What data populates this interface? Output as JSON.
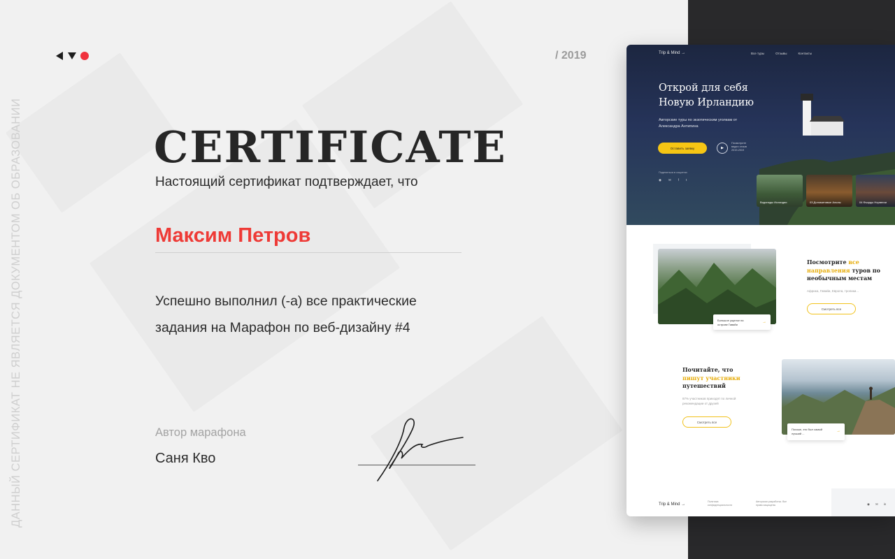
{
  "certificate": {
    "title": "CERTIFICATE",
    "subtitle": "Настоящий сертификат подтверждает, что",
    "recipient": "Максим Петров",
    "body_line1": "Успешно выполнил (-а) все практические",
    "body_line2": "задания на Марафон по веб-дизайну #4",
    "author_label": "Автор марафона",
    "author_name": "Саня Кво",
    "year": "/ 2019",
    "disclaimer": "ДАННЫЙ СЕРТИФИКАТ НЕ ЯВЛЯЕТСЯ ДОКУМЕНТОМ ОБ ОБРАЗОВАНИИ"
  },
  "colors": {
    "accent_red": "#ee3a36",
    "accent_yellow": "#f6c614",
    "dark_panel": "#29292b"
  },
  "logo": {
    "icons": [
      "triangle-left-icon",
      "triangle-down-icon",
      "red-dot-icon"
    ]
  },
  "mockup": {
    "logo": "Trip & Mind →",
    "nav": [
      "Все туры",
      "Отзывы",
      "Контакты"
    ],
    "hero_title_line1": "Открой для себя",
    "hero_title_line2": "Новую Ирландию",
    "hero_desc": "Авторские туры по экзотическим уголкам от Александра Антипина",
    "hero_button": "Оставить заявку",
    "play_text": "Посмотрите видео отзыв 2019-2019",
    "share_text": "Поделиться в соцсетях",
    "social": [
      "◉",
      "✉",
      "f",
      "t"
    ],
    "hero_cards": [
      {
        "label": "Водопады Исландии"
      },
      {
        "label": "03 Доломитовые Альпы"
      },
      {
        "label": "04 Фьорды Норвегии"
      }
    ],
    "section1": {
      "title_a": "Посмотрите ",
      "title_hl": "все направления",
      "title_b": " туров по необычным местам",
      "desc": "Африка, Гавайи, Европа, тропики...",
      "button": "Смотреть все",
      "tag": "Большое ущелье на острове Гавайи"
    },
    "section2": {
      "title_a": "Почитайте, что ",
      "title_hl": "пишут участники",
      "title_b": " путешествий",
      "desc": "87% участников приходят по личной рекомендации от друзей",
      "button": "Смотреть все",
      "tag": "Похоже, это был самый лучший ..."
    },
    "footer": {
      "logo": "Trip & Mind →",
      "col_a": "Политика конфиденциальности",
      "col_b": "Авторская разработка. Все права защищены",
      "social": [
        "◉",
        "✉",
        "in"
      ]
    }
  }
}
